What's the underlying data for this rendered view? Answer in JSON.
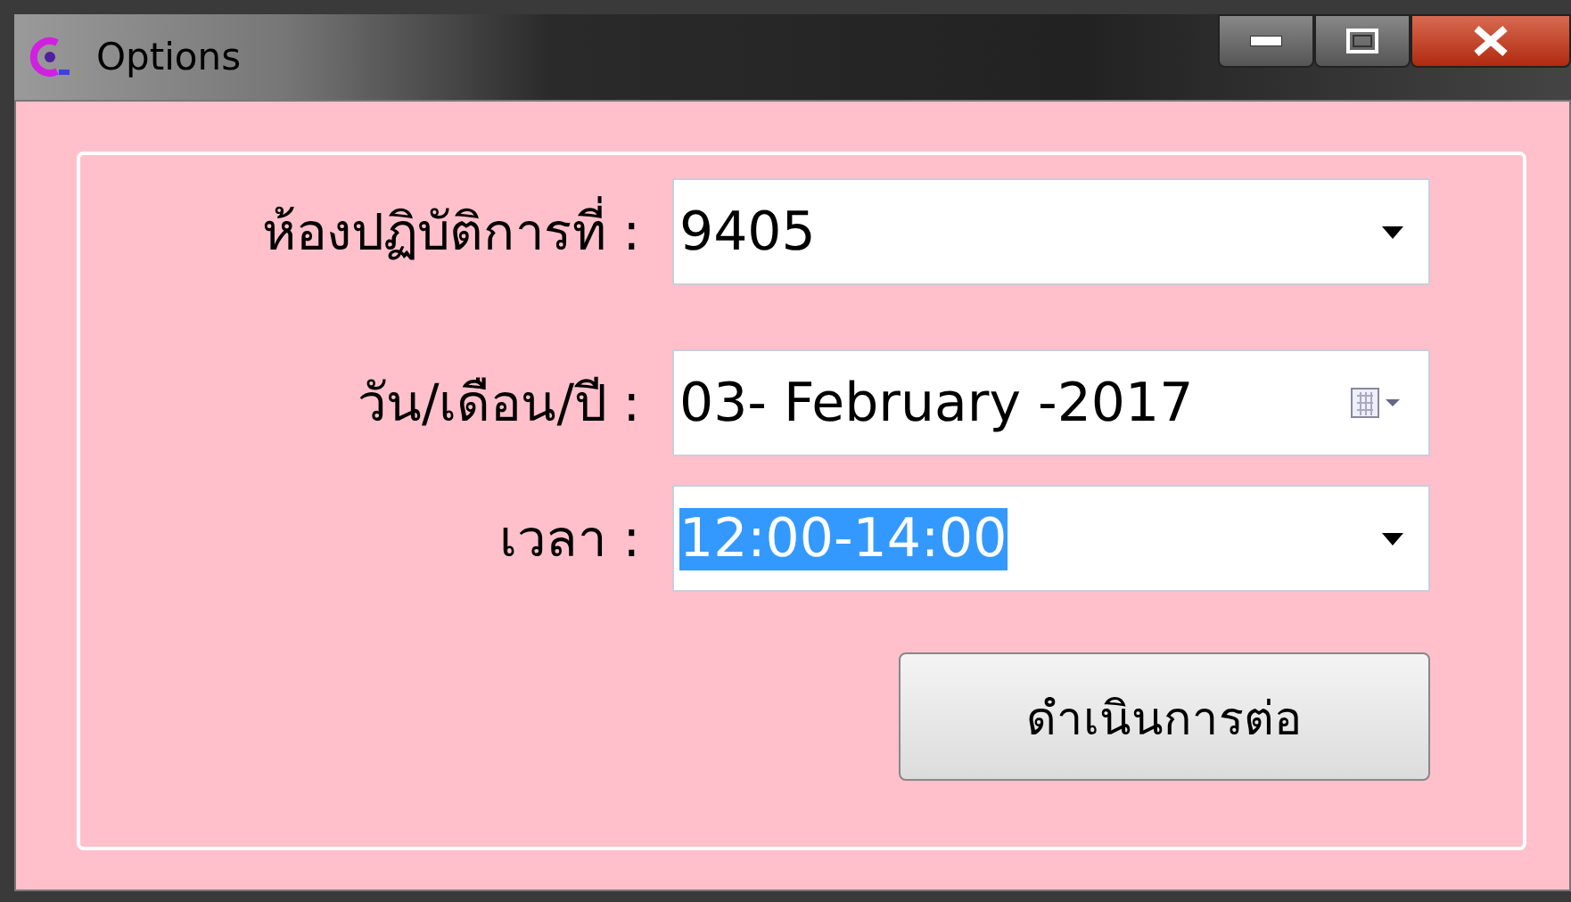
{
  "window": {
    "title": "Options"
  },
  "fields": [
    {
      "kind": "combo",
      "label": "ห้องปฏิบัติการที่ :",
      "value": "9405",
      "text_selected": false
    },
    {
      "kind": "date",
      "label": "วัน/เดือน/ปี :",
      "value": "03- February -2017"
    },
    {
      "kind": "combo",
      "label": "เวลา :",
      "value": "12:00-14:00",
      "text_selected": true
    }
  ],
  "button": "ดำเนินการต่อ"
}
